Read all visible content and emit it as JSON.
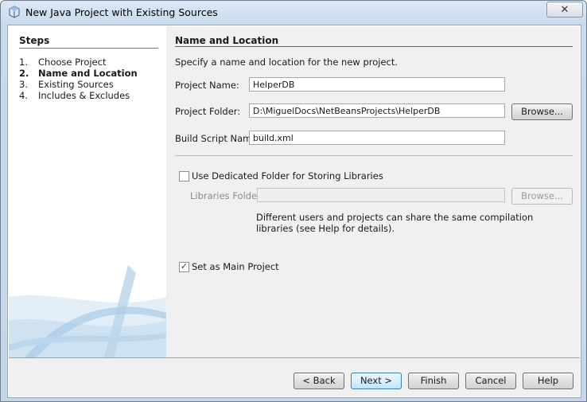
{
  "window": {
    "title": "New Java Project with Existing Sources",
    "close_glyph": "✕"
  },
  "steps": {
    "heading": "Steps",
    "items": [
      {
        "num": "1.",
        "label": "Choose Project"
      },
      {
        "num": "2.",
        "label": "Name and Location"
      },
      {
        "num": "3.",
        "label": "Existing Sources"
      },
      {
        "num": "4.",
        "label": "Includes & Excludes"
      }
    ],
    "active_index": 1
  },
  "panel": {
    "heading": "Name and Location",
    "instruction": "Specify a name and location for the new project.",
    "project_name": {
      "label": "Project Name:",
      "value": "HelperDB"
    },
    "project_folder": {
      "label": "Project Folder:",
      "value": "D:\\MiguelDocs\\NetBeansProjects\\HelperDB",
      "browse": "Browse..."
    },
    "build_script": {
      "label": "Build Script Name:",
      "value": "build.xml"
    },
    "dedicated_folder": {
      "label": "Use Dedicated Folder for Storing Libraries",
      "checked": false
    },
    "libraries_folder": {
      "label": "Libraries Folder:",
      "value": "",
      "browse": "Browse..."
    },
    "help_line1": "Different users and projects can share the same compilation",
    "help_line2": "libraries (see Help for details).",
    "main_project": {
      "label": "Set as Main Project",
      "checked": true,
      "check_glyph": "✓"
    }
  },
  "footer": {
    "back": "< Back",
    "next": "Next >",
    "finish": "Finish",
    "cancel": "Cancel",
    "help": "Help"
  },
  "icons": {
    "title": "project-cube-icon"
  },
  "colors": {
    "titlebar": "#c9daec",
    "steps_bg": "#ffffff",
    "panel_bg": "#f0f0f0",
    "default_button": "#3c7fb1"
  }
}
